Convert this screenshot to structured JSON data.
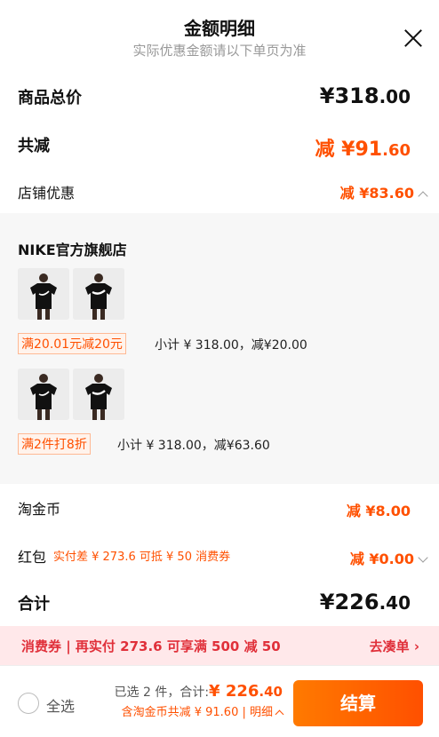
{
  "header": {
    "title": "金额明细",
    "subtitle": "实际优惠金额请以下单页为准"
  },
  "total": {
    "label": "商品总价",
    "prefix": "¥",
    "int": "318",
    "dec": ".00"
  },
  "reduce": {
    "label": "共减",
    "prefix": "减 ¥",
    "int": "91",
    "dec": ".60"
  },
  "shop_discount": {
    "label": "店铺优惠",
    "value": "减 ¥83.60"
  },
  "shop": {
    "name": "NIKE官方旗舰店",
    "groups": [
      {
        "tag": "满20.01元减20元",
        "subtotal": "小计 ¥ 318.00，减¥20.00"
      },
      {
        "tag": "满2件打8折",
        "subtotal": "小计 ¥ 318.00，减¥63.60"
      }
    ]
  },
  "taojinbi": {
    "label": "淘金币",
    "value": "减 ¥8.00"
  },
  "hongbao": {
    "label": "红包",
    "note": "实付差 ¥ 273.6 可抵 ¥ 50 消费券",
    "value": "减 ¥0.00"
  },
  "sum": {
    "label": "合计",
    "prefix": "¥",
    "int": "226",
    "dec": ".40"
  },
  "banner": {
    "left": "消费券 | 再实付 273.6 可享满 500 减 50",
    "right": "去凑单 ›"
  },
  "footer": {
    "select_all": "全选",
    "selected": "已选 2 件，合计:",
    "amount_prefix": "¥ ",
    "amount_int": "226",
    "amount_dec": ".40",
    "detail": "含淘金币共减 ¥ 91.60 | 明细",
    "checkout": "结算"
  },
  "colors": {
    "accent": "#ff5000",
    "banner_text": "#e0303a",
    "banner_bg": "#ffe8ea"
  }
}
